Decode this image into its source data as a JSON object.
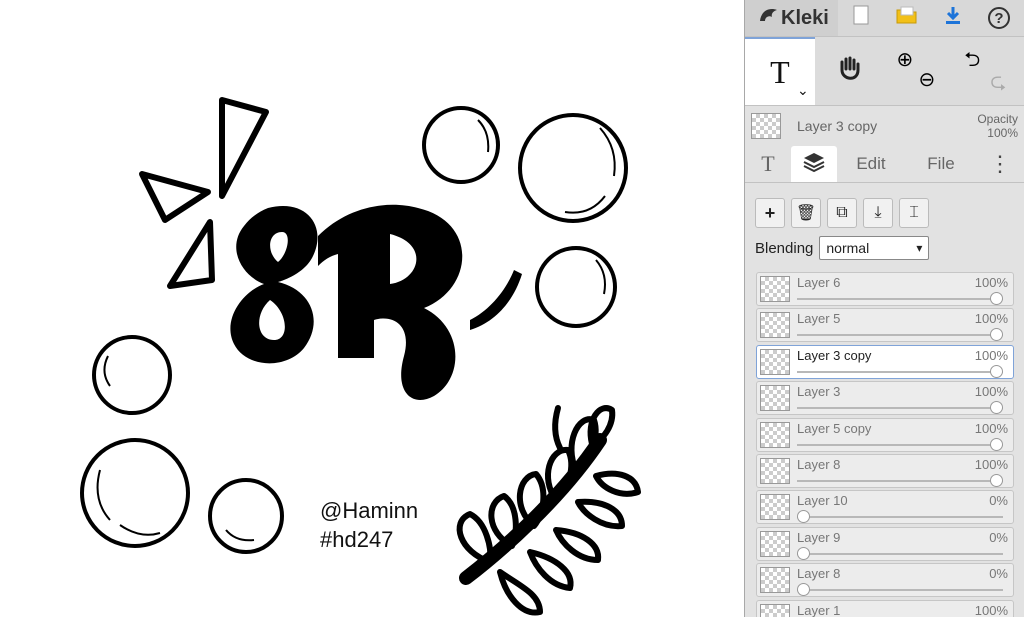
{
  "app": {
    "name": "Kleki"
  },
  "canvas": {
    "watermark_line1": "@Haminn",
    "watermark_line2": "#hd247",
    "art_text": "8R"
  },
  "toolbar": {
    "new_icon": "new-page-icon",
    "open_icon": "folder-icon",
    "download_icon": "download-icon",
    "help_label": "?"
  },
  "tools": {
    "text_tool_label": "T",
    "text_tool_dropdown": "⌄"
  },
  "current_layer": {
    "name": "Layer 3 copy",
    "opacity_label": "Opacity",
    "opacity_value": "100%"
  },
  "tabs": {
    "text_label": "T",
    "edit_label": "Edit",
    "file_label": "File",
    "more_label": "⋮"
  },
  "blending": {
    "label": "Blending",
    "value": "normal"
  },
  "layers": [
    {
      "name": "Layer 6",
      "opacity": "100%",
      "level": 1.0,
      "selected": false
    },
    {
      "name": "Layer 5",
      "opacity": "100%",
      "level": 1.0,
      "selected": false
    },
    {
      "name": "Layer 3 copy",
      "opacity": "100%",
      "level": 1.0,
      "selected": true
    },
    {
      "name": "Layer 3",
      "opacity": "100%",
      "level": 1.0,
      "selected": false
    },
    {
      "name": "Layer 5 copy",
      "opacity": "100%",
      "level": 1.0,
      "selected": false
    },
    {
      "name": "Layer 8",
      "opacity": "100%",
      "level": 1.0,
      "selected": false
    },
    {
      "name": "Layer 10",
      "opacity": "0%",
      "level": 0.0,
      "selected": false
    },
    {
      "name": "Layer 9",
      "opacity": "0%",
      "level": 0.0,
      "selected": false
    },
    {
      "name": "Layer 8",
      "opacity": "0%",
      "level": 0.0,
      "selected": false
    },
    {
      "name": "Layer 1",
      "opacity": "100%",
      "level": 1.0,
      "selected": false
    }
  ]
}
